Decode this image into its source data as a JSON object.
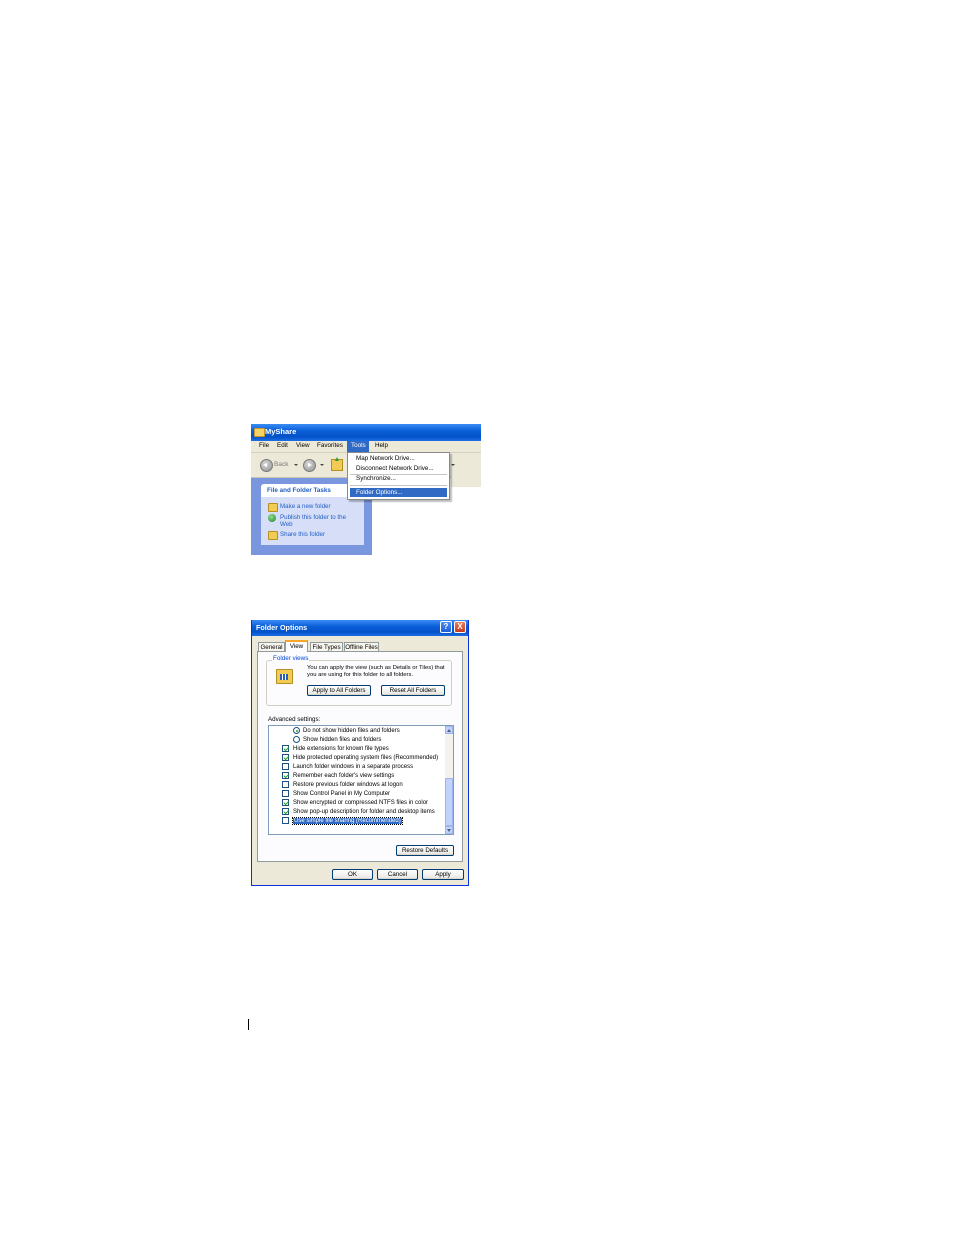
{
  "explorer": {
    "title": "MyShare",
    "menu": [
      "File",
      "Edit",
      "View",
      "Favorites",
      "Tools",
      "Help"
    ],
    "toolbar": {
      "back_label": "Back"
    },
    "tools_menu": {
      "items": [
        "Map Network Drive...",
        "Disconnect Network Drive...",
        "Synchronize...",
        "Folder Options..."
      ],
      "highlighted": "Folder Options..."
    },
    "tasks": {
      "header": "File and Folder Tasks",
      "links": [
        "Make a new folder",
        "Publish this folder to the",
        "Web",
        "Share this folder"
      ]
    }
  },
  "dialog": {
    "title": "Folder Options",
    "title_buttons": {
      "help": "?",
      "close": "X"
    },
    "tabs": [
      "General",
      "View",
      "File Types",
      "Offline Files"
    ],
    "active_tab": "View",
    "folder_views": {
      "group_label": "Folder views",
      "description_line1": "You can apply the view (such as Details or Tiles) that",
      "description_line2": "you are using for this folder to all folders.",
      "apply_button": "Apply to All Folders",
      "reset_button": "Reset All Folders"
    },
    "advanced_label": "Advanced settings:",
    "settings": [
      {
        "type": "radio",
        "label": "Do not show hidden files and folders",
        "checked": true
      },
      {
        "type": "radio",
        "label": "Show hidden files and folders",
        "checked": false
      },
      {
        "type": "checkbox",
        "label": "Hide extensions for known file types",
        "checked": true
      },
      {
        "type": "checkbox",
        "label": "Hide protected operating system files (Recommended)",
        "checked": true
      },
      {
        "type": "checkbox",
        "label": "Launch folder windows in a separate process",
        "checked": false
      },
      {
        "type": "checkbox",
        "label": "Remember each folder's view settings",
        "checked": true
      },
      {
        "type": "checkbox",
        "label": "Restore previous folder windows at logon",
        "checked": false
      },
      {
        "type": "checkbox",
        "label": "Show Control Panel in My Computer",
        "checked": false
      },
      {
        "type": "checkbox",
        "label": "Show encrypted or compressed NTFS files in color",
        "checked": true
      },
      {
        "type": "checkbox",
        "label": "Show pop-up description for folder and desktop items",
        "checked": true
      },
      {
        "type": "checkbox",
        "label": "Use simple file sharing (Recommended)",
        "checked": false,
        "selected": true
      }
    ],
    "restore_defaults_button": "Restore Defaults",
    "ok_button": "OK",
    "cancel_button": "Cancel",
    "apply_button": "Apply"
  }
}
